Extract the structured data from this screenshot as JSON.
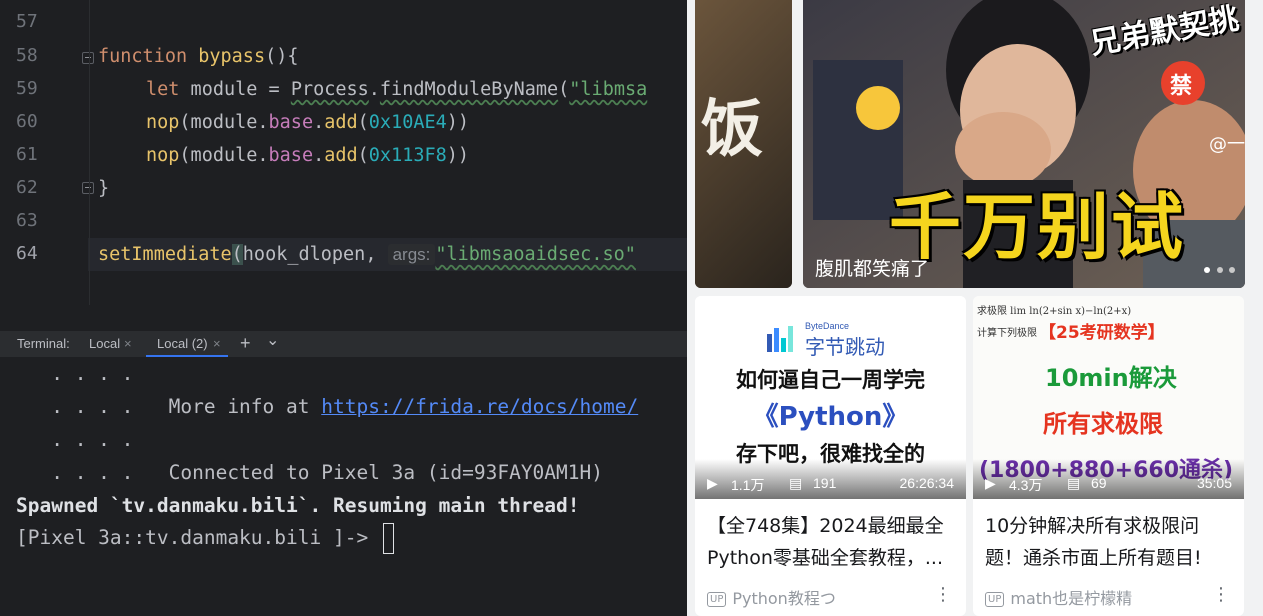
{
  "editor": {
    "lines": [
      {
        "num": "57"
      },
      {
        "num": "58"
      },
      {
        "num": "59"
      },
      {
        "num": "60"
      },
      {
        "num": "61"
      },
      {
        "num": "62"
      },
      {
        "num": "63"
      },
      {
        "num": "64"
      }
    ],
    "code": {
      "l58_kw": "function",
      "l58_name": "bypass",
      "l58_rest": "(){",
      "l59_kw": "let",
      "l59_var": " module = ",
      "l59_obj": "Process",
      "l59_dot": ".",
      "l59_fn": "findModuleByName",
      "l59_paren": "(",
      "l59_str": "\"libmsa",
      "l60_fn": "nop",
      "l60_a": "(module.",
      "l60_prop": "base",
      "l60_b": ".",
      "l60_fn2": "add",
      "l60_c": "(",
      "l60_num": "0x10AE4",
      "l60_d": "))",
      "l61_fn": "nop",
      "l61_a": "(module.",
      "l61_prop": "base",
      "l61_b": ".",
      "l61_fn2": "add",
      "l61_c": "(",
      "l61_num": "0x113F8",
      "l61_d": "))",
      "l62": "}",
      "l64_fn": "setImmediate",
      "l64_paren": "(",
      "l64_arg": "hook_dlopen, ",
      "l64_hint": "args:",
      "l64_str": "\"libmsaoaidsec.so\""
    }
  },
  "terminal": {
    "label": "Terminal:",
    "tabs": [
      {
        "label": "Local"
      },
      {
        "label": "Local (2)"
      }
    ],
    "add": "+",
    "chevron": "⌄",
    "lines": {
      "l1": "   . . . .",
      "l2a": "   . . . .   More info at ",
      "l2link": "https://frida.re/docs/home/",
      "l3": "   . . . .",
      "l4": "   . . . .   Connected to Pixel 3a (id=93FAY0AM1H)",
      "l5": "Spawned `tv.danmaku.bili`. Resuming main thread!",
      "l6": "[Pixel 3a::tv.danmaku.bili ]-> "
    }
  },
  "feed": {
    "banner": {
      "left_text": "饭",
      "title_top": "兄弟默契挑",
      "big_text": "千万别试",
      "caption": "腹肌都笑痛了",
      "badge": "禁",
      "watermark": "@一"
    },
    "cards": [
      {
        "thumb_brand_small": "ByteDance",
        "thumb_brand": "字节跳动",
        "thumb_l1": "如何逼自己一周学完",
        "thumb_l2": "《Python》",
        "thumb_l3": "存下吧，很难找全的",
        "views": "1.1万",
        "comments": "191",
        "duration": "26:26:34",
        "title_l1": "【全748集】2024最细最全",
        "title_l2": "Python零基础全套教程，...",
        "author": "Python教程つ"
      },
      {
        "thumb_l1": "【25考研数学】",
        "thumb_l2": "10min解决",
        "thumb_l3": "所有求极限",
        "thumb_l4": "(1800+880+660通杀)",
        "thumb_formula1": "求极限 lim  ln(2+sin x)−ln(2+x)",
        "thumb_formula2": "计算下列极限",
        "views": "4.3万",
        "comments": "69",
        "duration": "35:05",
        "title_l1": "10分钟解决所有求极限问",
        "title_l2": "题！通杀市面上所有题目!",
        "author": "math也是柠檬精"
      }
    ],
    "up_badge": "UP",
    "more_icon": "⋮"
  }
}
